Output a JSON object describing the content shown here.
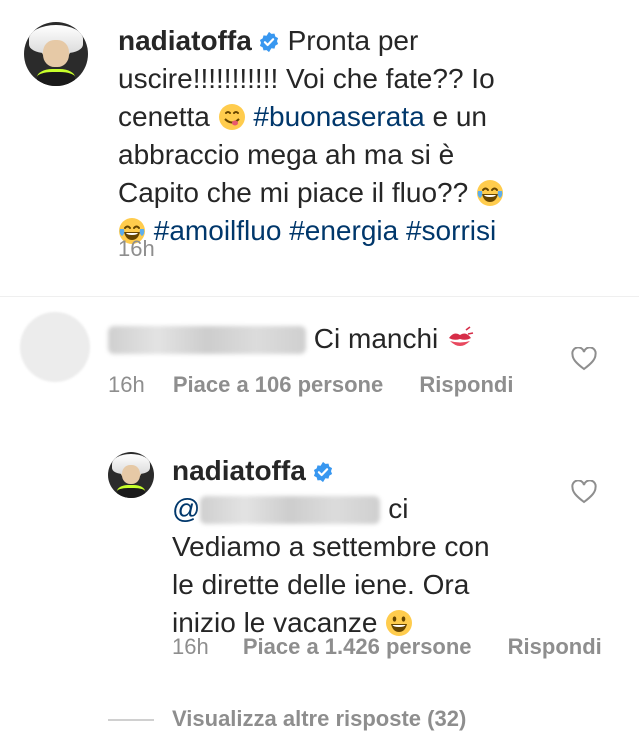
{
  "post": {
    "username": "nadiatoffa",
    "caption_line1": "Pronta per",
    "caption_line2": "uscire!!!!!!!!!!! Voi che fate?? Io",
    "caption_line3_a": "cenetta",
    "caption_line3_tag": "#buonaserata",
    "caption_line3_b": "e un",
    "caption_line4": "abbraccio mega ah ma si è",
    "caption_line5": "Capito che mi piace il fluo??",
    "hashtags": [
      "#amoilfluo",
      "#energia",
      "#sorrisi"
    ],
    "time": "16h"
  },
  "comment1": {
    "text": "Ci manchi",
    "time": "16h",
    "likes": "Piace a 106 persone",
    "reply_label": "Rispondi"
  },
  "reply1": {
    "username": "nadiatoffa",
    "mention_prefix": "@",
    "line1_tail": "ci",
    "line2": "Vediamo a settembre con",
    "line3": "le dirette delle iene. Ora",
    "line4": "inizio le vacanze",
    "time": "16h",
    "likes": "Piace a 1.426 persone",
    "reply_label": "Rispondi"
  },
  "more_replies": "Visualizza altre risposte (32)",
  "icons": {
    "verified": "verified-badge-icon",
    "heart": "heart-outline-icon",
    "emoji_yum": "face-savoring-food-emoji",
    "emoji_laugh": "tears-of-joy-emoji",
    "emoji_kiss": "kiss-mark-emoji",
    "emoji_grin": "grinning-face-emoji"
  },
  "colors": {
    "hashtag": "#00376b",
    "meta": "#8e8e8e",
    "verified": "#3897f0"
  }
}
